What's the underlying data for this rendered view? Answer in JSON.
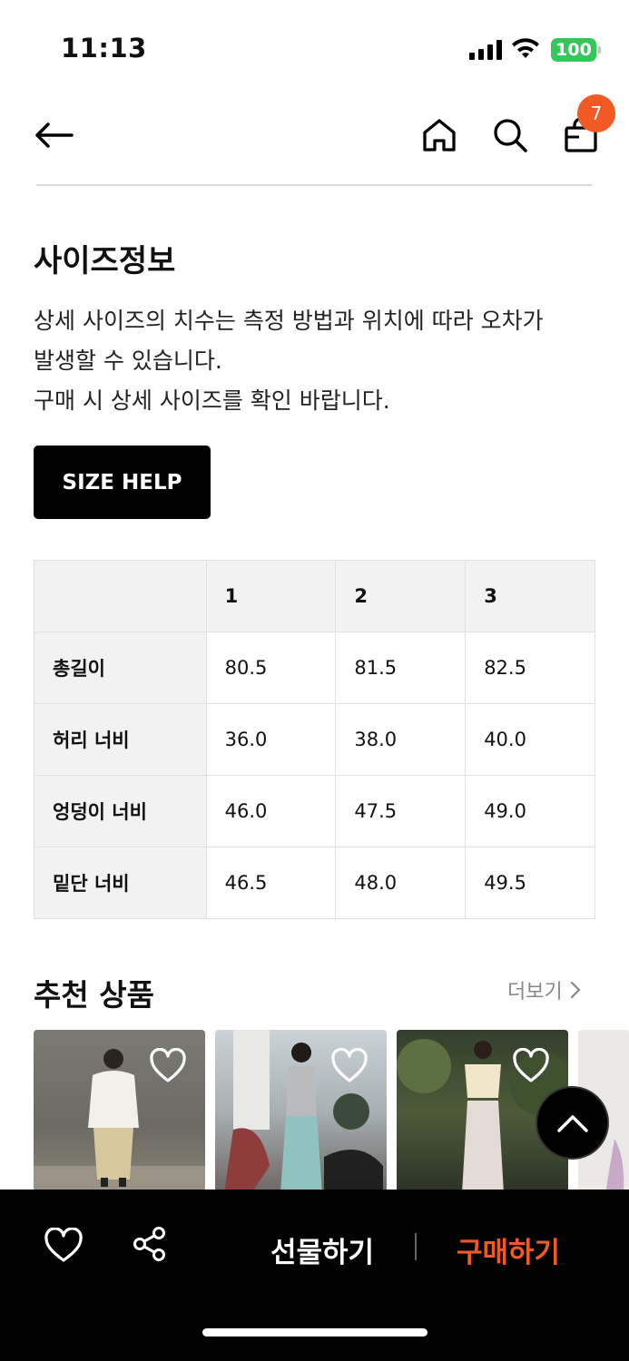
{
  "status_bar": {
    "time": "11:13",
    "battery": "100"
  },
  "header": {
    "cart_count": "7"
  },
  "size_info": {
    "title": "사이즈정보",
    "notice_lines": [
      "상세 사이즈의 치수는 측정 방법과 위치에 따라 오차가",
      "발생할 수 있습니다.",
      "구매 시 상세 사이즈를 확인 바랍니다."
    ],
    "help_button": "SIZE HELP",
    "table": {
      "columns": [
        "",
        "1",
        "2",
        "3"
      ],
      "rows": [
        {
          "label": "총길이",
          "values": [
            "80.5",
            "81.5",
            "82.5"
          ]
        },
        {
          "label": "허리 너비",
          "values": [
            "36.0",
            "38.0",
            "40.0"
          ]
        },
        {
          "label": "엉덩이 너비",
          "values": [
            "46.0",
            "47.5",
            "49.0"
          ]
        },
        {
          "label": "밑단 너비",
          "values": [
            "46.5",
            "48.0",
            "49.5"
          ]
        }
      ]
    }
  },
  "recommended": {
    "title": "추천 상품",
    "more_label": "더보기"
  },
  "bottom_bar": {
    "gift_label": "선물하기",
    "buy_label": "구매하기"
  },
  "colors": {
    "accent": "#f15a24",
    "battery": "#34c759"
  },
  "icons": [
    "back-arrow-icon",
    "home-icon",
    "search-icon",
    "shopping-bag-icon",
    "heart-icon",
    "share-icon",
    "chevron-up-icon",
    "chevron-right-icon"
  ]
}
